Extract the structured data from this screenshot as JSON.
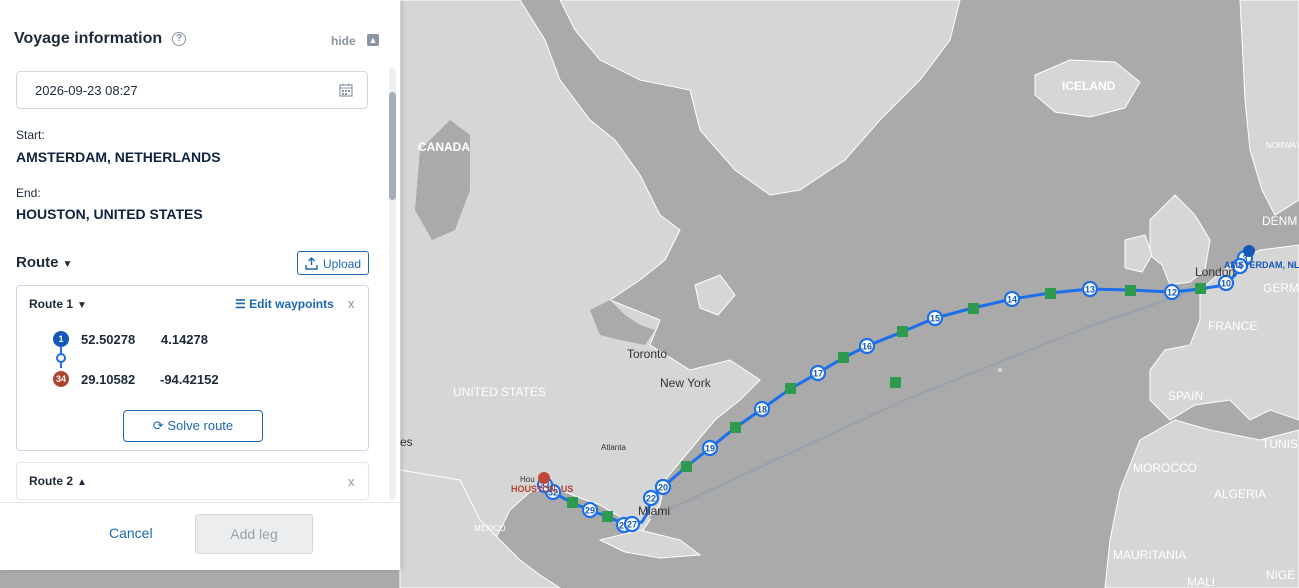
{
  "panel": {
    "title": "Voyage information",
    "help_icon": "?",
    "hide_label": "hide",
    "date_value": "2026-09-23 08:27",
    "start_label": "Start:",
    "start_value": "AMSTERDAM, NETHERLANDS",
    "end_label": "End:",
    "end_value": "HOUSTON, UNITED STATES",
    "route_heading": "Route",
    "upload_label": "Upload",
    "routes": [
      {
        "name": "Route 1",
        "edit_label": "Edit waypoints",
        "close": "x",
        "waypoints": [
          {
            "badge": "1",
            "lat": "52.50278",
            "lon": "4.14278",
            "color": "#1557b8"
          },
          {
            "badge": "34",
            "lat": "29.10582",
            "lon": "-94.42152",
            "color": "#b0432f"
          }
        ],
        "solve_label": "Solve route"
      },
      {
        "name": "Route 2",
        "close": "x"
      }
    ],
    "cancel_label": "Cancel",
    "add_leg_label": "Add leg"
  },
  "map": {
    "labels": {
      "iceland": "ICELAND",
      "canada": "CANADA",
      "norway": "NORWAY",
      "denmark": "DENM",
      "amsterdam": "AMSTERDAM, NL",
      "london": "London",
      "germany": "GERM",
      "france": "FRANCE",
      "spain": "SPAIN",
      "tunisia": "TUNIS",
      "morocco": "MOROCCO",
      "algeria": "ALGERIA",
      "mauritania": "MAURITANIA",
      "mali": "MALI",
      "niger": "NIGE",
      "toronto": "Toronto",
      "new_york": "New York",
      "united_states": "UNITED STATES",
      "atlanta": "Atlanta",
      "mexico": "MEXICO",
      "houston": "HOUSTON, US",
      "houston_city": "Hou",
      "miami": "Miami",
      "es": "es"
    },
    "waypoint_numbers": [
      "10",
      "12",
      "13",
      "14",
      "15",
      "16",
      "17",
      "18",
      "19",
      "20",
      "22",
      "26",
      "27",
      "29",
      "32",
      "33",
      "3",
      "4"
    ],
    "colors": {
      "route": "#1c6fe8",
      "route_alt": "#9aa3ad",
      "waypoint_fill": "#ffffff",
      "marker_green": "#2e9a4e",
      "destination": "#c0463a"
    }
  }
}
